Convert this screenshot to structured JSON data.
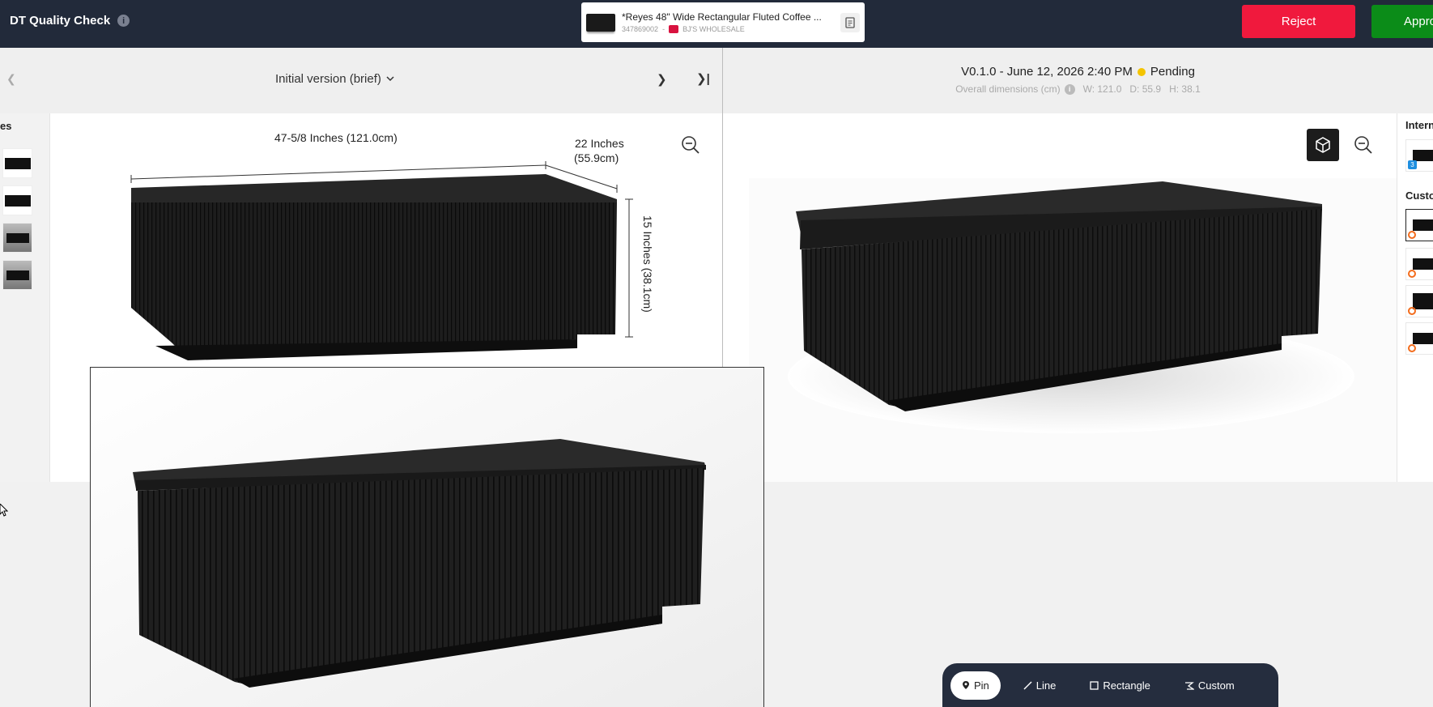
{
  "app": {
    "title": "DT Quality Check"
  },
  "product": {
    "name": "*Reyes 48\" Wide Rectangular Fluted Coffee ...",
    "id": "347869002",
    "separator": "-",
    "retailer": "BJ'S WHOLESALE"
  },
  "actions": {
    "reject": "Reject",
    "approve": "Appro"
  },
  "left_panel": {
    "version_label": "Initial version (brief)",
    "thumbnails_label": "es",
    "dimension_width": "47-5/8 Inches (121.0cm)",
    "dimension_depth_line1": "22 Inches",
    "dimension_depth_line2": "(55.9cm)",
    "dimension_height": "15 Inches (38.1cm)"
  },
  "right_panel": {
    "version_title": "V0.1.0 - June 12, 2026 2:40 PM",
    "status": "Pending",
    "dims_label": "Overall dimensions (cm)",
    "dims_w": "W: 121.0",
    "dims_d": "D: 55.9",
    "dims_h": "H: 38.1",
    "sidebar_internal_label": "Intern",
    "sidebar_custom_label": "Custo",
    "internal_badge": "3"
  },
  "toolbar": {
    "pin": "Pin",
    "line": "Line",
    "rectangle": "Rectangle",
    "custom": "Custom"
  },
  "colors": {
    "topbar": "#222a3a",
    "reject": "#f0193d",
    "approve": "#0b8c18",
    "pending": "#f4c400",
    "furniture": "#1e1e1e"
  }
}
